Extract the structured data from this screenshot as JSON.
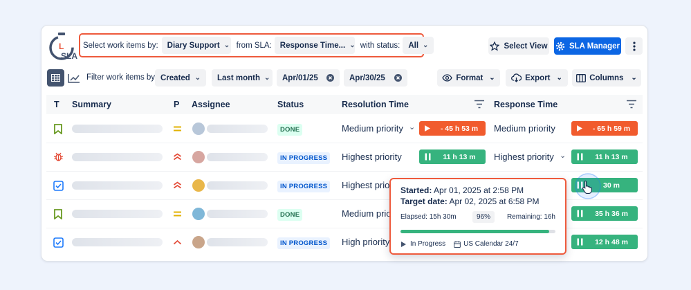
{
  "toolbar": {
    "select_label": "Select work items by:",
    "work_items_value": "Diary Support",
    "sla_label": "from SLA:",
    "sla_value": "Response Time...",
    "status_label": "with status:",
    "status_value": "All",
    "select_view_label": "Select View",
    "sla_manager_label": "SLA Manager"
  },
  "logo": {
    "letter": "L",
    "text": "SLA"
  },
  "filter_bar": {
    "filter_label": "Filter work items by:",
    "created_value": "Created",
    "period_value": "Last month",
    "date_from": "Apr/01/25",
    "date_to": "Apr/30/25",
    "format_label": "Format",
    "export_label": "Export",
    "columns_label": "Columns"
  },
  "table": {
    "headers": {
      "type": "T",
      "summary": "Summary",
      "priority": "P",
      "assignee": "Assignee",
      "status": "Status",
      "resolution": "Resolution Time",
      "response": "Response Time"
    },
    "rows": [
      {
        "type_icon": "bookmark-icon",
        "priority_icon": "priority-medium-icon",
        "status": "DONE",
        "resolution_priority": "Medium priority",
        "resolution_time": "- 45 h 53 m",
        "response_priority": "Medium priority",
        "response_time": "- 65 h 59 m"
      },
      {
        "type_icon": "bug-icon",
        "priority_icon": "priority-highest-icon",
        "status": "IN PROGRESS",
        "resolution_priority": "Highest priority",
        "resolution_time": "11 h 13 m",
        "response_priority": "Highest priority",
        "response_time": "11 h 13 m"
      },
      {
        "type_icon": "checkbox-icon",
        "priority_icon": "priority-highest-icon",
        "status": "IN PROGRESS",
        "resolution_priority": "Highest priori",
        "resolution_time": "",
        "response_priority": "",
        "response_time": "30 m"
      },
      {
        "type_icon": "bookmark-icon",
        "priority_icon": "priority-medium-icon",
        "status": "DONE",
        "resolution_priority": "Medium priori",
        "resolution_time": "",
        "response_priority": "",
        "response_time": "35 h 36 m"
      },
      {
        "type_icon": "checkbox-icon",
        "priority_icon": "priority-high-icon",
        "status": "IN PROGRESS",
        "resolution_priority": "High priority",
        "resolution_time": "",
        "response_priority": "",
        "response_time": "12 h 48 m"
      }
    ]
  },
  "tooltip": {
    "started_label": "Started:",
    "started_value": "Apr 01, 2025 at 2:58 PM",
    "target_label": "Target date:",
    "target_value": "Apr 02, 2025 at 6:58 PM",
    "elapsed": "Elapsed: 15h 30m",
    "percent": "96%",
    "progress": 0.96,
    "remaining": "Remaining: 16h",
    "state": "In Progress",
    "calendar": "US Calendar 24/7"
  },
  "colors": {
    "accent": "#0c66e4",
    "overdue": "#f15b2d",
    "running": "#36b37e",
    "highlight": "#ee5a3c"
  }
}
